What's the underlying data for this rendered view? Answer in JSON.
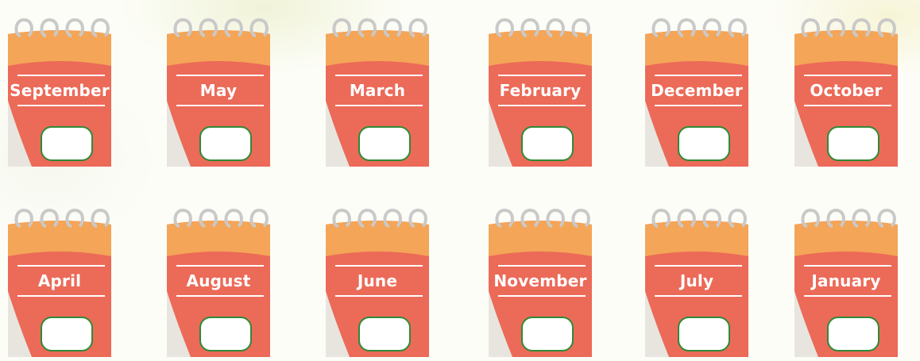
{
  "rows": [
    {
      "months": [
        "September",
        "May",
        "March",
        "February",
        "December",
        "October"
      ]
    },
    {
      "months": [
        "April",
        "August",
        "June",
        "November",
        "July",
        "January"
      ]
    }
  ],
  "colors": {
    "calendar_top": "#f4a557",
    "calendar_body": "#ec6a58",
    "page_curl": "#e8e5df",
    "rings": "#c9c9c9",
    "box_border": "#2f8a36",
    "label_text": "#ffffff"
  }
}
